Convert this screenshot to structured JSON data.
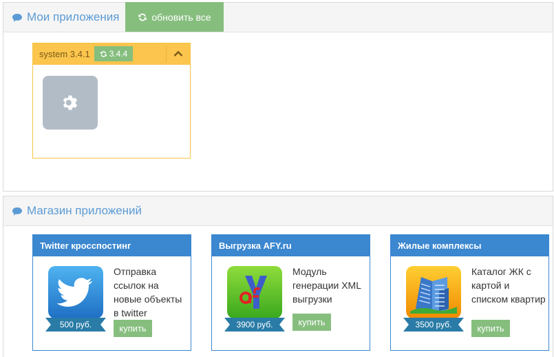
{
  "my_apps": {
    "title": "Мои приложения",
    "update_all_label": "обновить все",
    "apps": [
      {
        "name": "system 3.4.1",
        "update_version": "3.4.4",
        "icon": "gear-icon"
      }
    ]
  },
  "store": {
    "title": "Магазин приложений",
    "items": [
      {
        "title": "Twitter кросспостинг",
        "description": "Отправка ссылок на новые объекты в twitter",
        "price": "500 руб.",
        "buy_label": "купить",
        "icon": "twitter-bird-icon"
      },
      {
        "title": "Выгрузка AFY.ru",
        "description": "Модуль генерации XML выгрузки",
        "price": "3900 руб.",
        "buy_label": "купить",
        "icon": "afy-logo-icon"
      },
      {
        "title": "Жилые комплексы",
        "description": "Каталог ЖК с картой и списком квартир",
        "price": "3500 руб.",
        "buy_label": "купить",
        "icon": "buildings-icon"
      }
    ]
  },
  "colors": {
    "accent": "#5b9bd5",
    "green": "#86be7e",
    "yellow": "#fcc54d",
    "blue": "#3b87d0"
  }
}
